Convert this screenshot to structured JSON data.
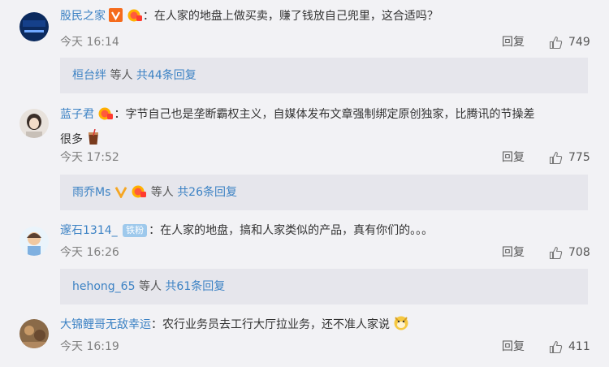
{
  "comments": [
    {
      "user": "股民之家",
      "text": "：在人家的地盘上做买卖，赚了钱放自己兜里，这合适吗？",
      "time": "今天 16:14",
      "reply": "回复",
      "likes": "749",
      "sub": {
        "user": "桓台绊",
        "mid": " 等人 ",
        "more": "共44条回复"
      }
    },
    {
      "user": "蓝子君",
      "text": "：字节自己也是垄断霸权主义，自媒体发布文章强制绑定原创独家，比腾讯的节操差",
      "text2": "很多",
      "time": "今天 17:52",
      "reply": "回复",
      "likes": "775",
      "sub": {
        "user": "雨乔Ms",
        "mid": " 等人 ",
        "more": "共26条回复"
      }
    },
    {
      "user": "邃石1314_",
      "badge": "铁粉",
      "text": "：在人家的地盘，搞和人家类似的产品，真有你们的。。。",
      "time": "今天 16:26",
      "reply": "回复",
      "likes": "708",
      "sub": {
        "user": "hehong_65",
        "mid": " 等人 ",
        "more": "共61条回复"
      }
    },
    {
      "user": "大锦鲤哥无敌幸运",
      "text": "：农行业务员去工行大厅拉业务，还不准人家说",
      "time": "今天 16:19",
      "reply": "回复",
      "likes": "411"
    }
  ],
  "colors": {
    "link": "#3c82c4",
    "bg": "#f2f2f5",
    "sub_bg": "#e6e6ec",
    "vip": "#f5a623"
  }
}
